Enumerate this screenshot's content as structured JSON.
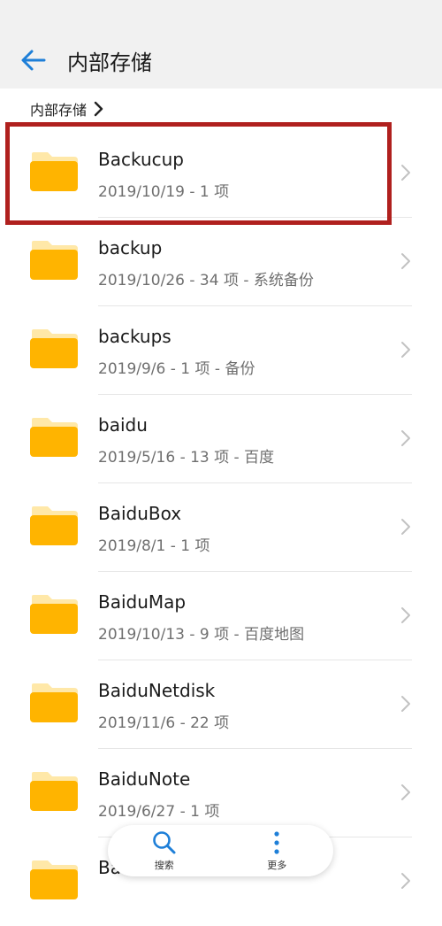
{
  "header": {
    "title": "内部存储",
    "back_icon": "arrow-left-icon",
    "accent": "#1e7fd8"
  },
  "breadcrumb": {
    "label": "内部存储",
    "icon": "chevron-right-icon"
  },
  "folder_color": "#FFB400",
  "folders": [
    {
      "name": "Backucup",
      "meta": "2019/10/19 - 1 项"
    },
    {
      "name": "backup",
      "meta": "2019/10/26 - 34 项 - 系统备份"
    },
    {
      "name": "backups",
      "meta": "2019/9/6 - 1 项 - 备份"
    },
    {
      "name": "baidu",
      "meta": "2019/5/16 - 13 项 - 百度"
    },
    {
      "name": "BaiduBox",
      "meta": "2019/8/1 - 1 项"
    },
    {
      "name": "BaiduMap",
      "meta": "2019/10/13 - 9 项 - 百度地图"
    },
    {
      "name": "BaiduNetdisk",
      "meta": "2019/11/6 - 22 项"
    },
    {
      "name": "BaiduNote",
      "meta": "2019/6/27 - 1 项"
    },
    {
      "name": "Ba",
      "meta": ""
    }
  ],
  "highlight_color": "#b0201e",
  "bottom_bar": {
    "search_label": "搜索",
    "more_label": "更多"
  }
}
